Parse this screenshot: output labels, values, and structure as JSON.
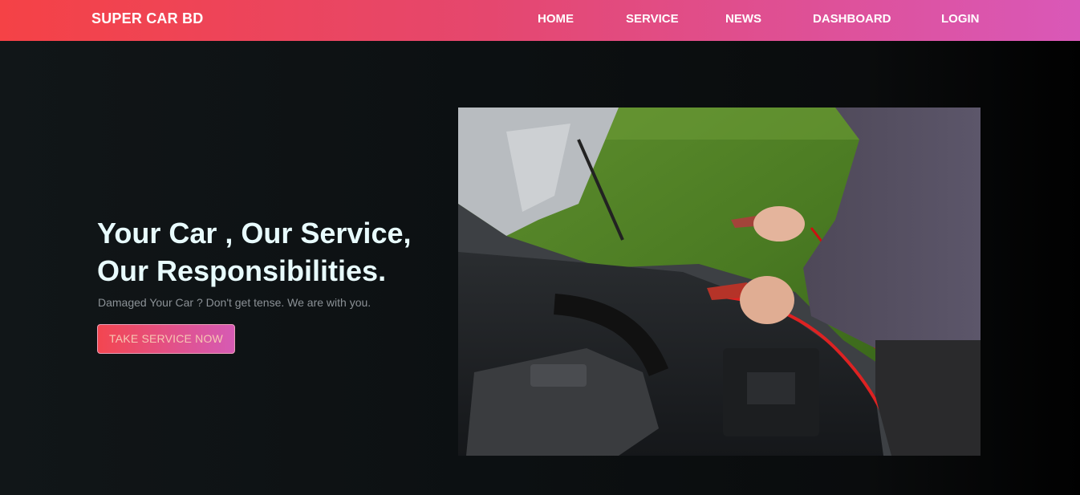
{
  "header": {
    "brand": "SUPER CAR BD",
    "nav": [
      "HOME",
      "SERVICE",
      "NEWS",
      "DASHBOARD",
      "LOGIN"
    ]
  },
  "hero": {
    "title_line1": "Your Car , Our Service,",
    "title_line2": "Our Responsibilities.",
    "subtitle": "Damaged Your Car ? Don't get tense. We are with you.",
    "cta_label": "TAKE SERVICE NOW",
    "image_description": "car-engine-jump-start-photo"
  },
  "colors": {
    "nav_gradient_start": "#f54246",
    "nav_gradient_end": "#d958b8",
    "hero_title": "#e8fbfd",
    "subtitle": "#8b9196"
  }
}
